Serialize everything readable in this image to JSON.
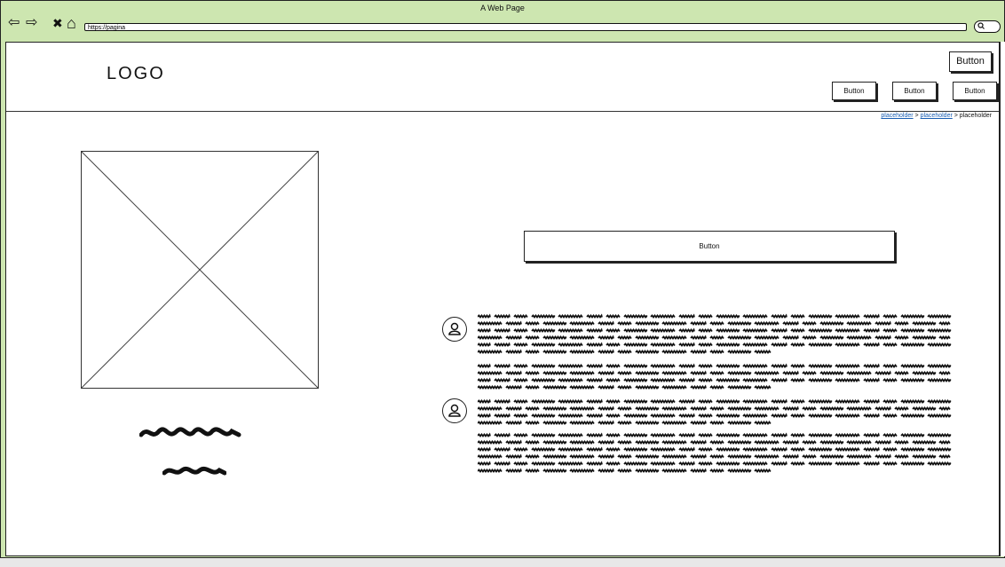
{
  "window": {
    "title": "A Web Page"
  },
  "browser": {
    "back_icon": "⇦",
    "forward_icon": "⇨",
    "close_icon": "✖",
    "home_icon": "⌂",
    "url": "https://pagina"
  },
  "header": {
    "logo": "LOGO",
    "top_button": "Button",
    "nav_buttons": [
      "Button",
      "Button",
      "Button"
    ]
  },
  "breadcrumb": {
    "items": [
      "placeholder",
      "placeholder",
      "placeholder"
    ],
    "separator": ">"
  },
  "main": {
    "action_button": "Button"
  },
  "comments": [
    {
      "avatar_icon": "user-icon"
    },
    {
      "avatar_icon": "user-icon"
    }
  ]
}
